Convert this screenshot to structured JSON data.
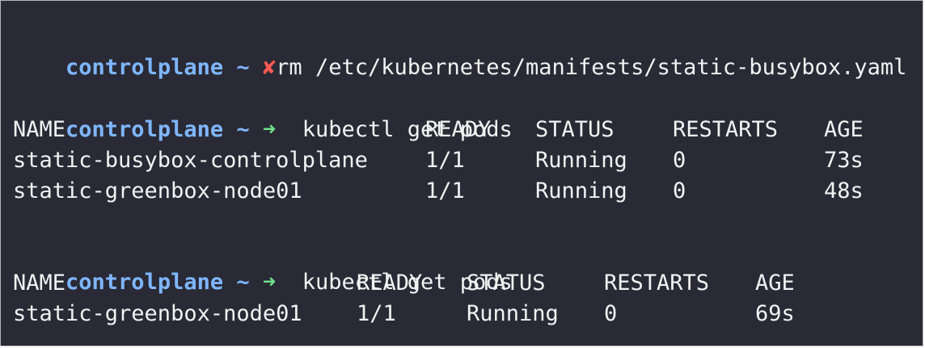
{
  "session": {
    "hostname": "controlplane",
    "cwd": "~",
    "fail_symbol": "✘",
    "ok_symbol": "➜"
  },
  "commands": [
    {
      "text": "rm /etc/kubernetes/manifests/static-busybox.yaml"
    },
    {
      "text": "kubectl get pods"
    },
    {
      "text": "kubectl get pods"
    }
  ],
  "outputs": [
    {
      "headers": [
        "NAME",
        "READY",
        "STATUS",
        "RESTARTS",
        "AGE"
      ],
      "rows": [
        [
          "static-busybox-controlplane",
          "1/1",
          "Running",
          "0",
          "73s"
        ],
        [
          "static-greenbox-node01",
          "1/1",
          "Running",
          "0",
          "48s"
        ]
      ]
    },
    {
      "headers": [
        "NAME",
        "READY",
        "STATUS",
        "RESTARTS",
        "AGE"
      ],
      "rows": [
        [
          "static-greenbox-node01",
          "1/1",
          "Running",
          "0",
          "69s"
        ]
      ]
    }
  ],
  "colors": {
    "background": "#292a35",
    "prompt": "#7fb6ff",
    "success_arrow": "#6fe08a",
    "fail_cross": "#ff5a52",
    "text": "#f2f2f2"
  }
}
